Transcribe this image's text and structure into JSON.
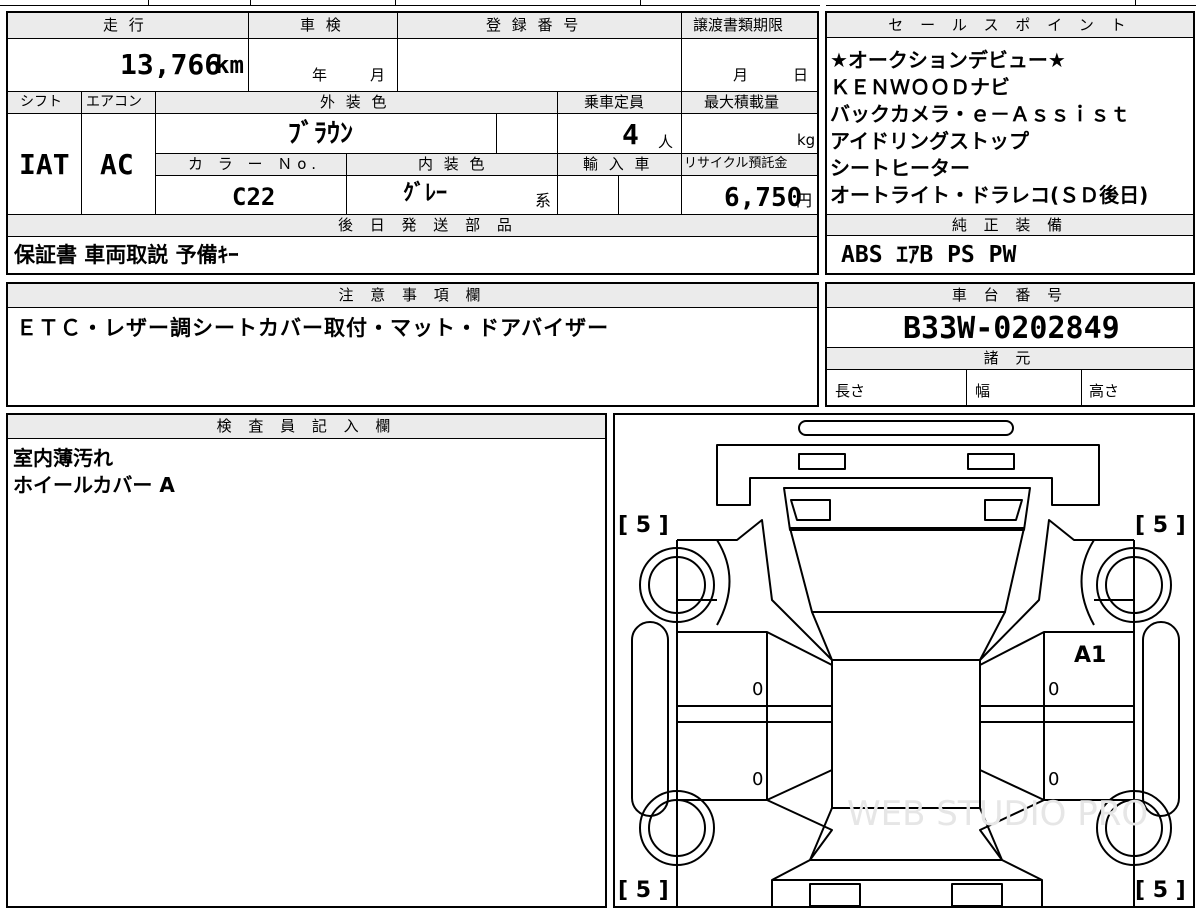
{
  "vehicle": {
    "header": {
      "mileage": "走 行",
      "inspection": "車 検",
      "registration_number": "登 録 番 号",
      "transfer_deadline": "譲渡書類期限"
    },
    "mileage_value": "13,766",
    "mileage_unit": "km",
    "inspection_year": "年",
    "inspection_month": "月",
    "deadline_month": "月",
    "deadline_day": "日",
    "shift_label": "シフト",
    "ac_label": "エアコン",
    "exterior_color_label": "外 装 色",
    "capacity_label": "乗車定員",
    "max_load_label": "最大積載量",
    "shift_value": "IAT",
    "ac_value": "AC",
    "exterior_color_value": "ﾌﾞﾗｳﾝ",
    "capacity_value": "4",
    "capacity_unit": "人",
    "max_load_unit": "kg",
    "color_no_label": "カ ラ ー Ｎo.",
    "interior_color_label": "内 装 色",
    "import_label": "輸 入 車",
    "recycle_label": "リサイクル預託金",
    "color_no_value": "C22",
    "interior_color_value": "ｸﾞﾚｰ",
    "interior_color_suffix": "系",
    "recycle_value": "6,750",
    "recycle_unit": "円",
    "later_parts_label": "後 日 発 送 部 品",
    "later_parts_value": "保証書 車両取説 予備ｷｰ"
  },
  "sales": {
    "header": "セ ー ル ス ポ イ ン ト",
    "lines": [
      "★オークションデビュー★",
      "ＫＥＮＷＯＯＤナビ",
      "バックカメラ・ｅ－Ａｓｓｉｓｔ",
      "アイドリングストップ",
      "シートヒーター",
      "オートライト・ドラレコ(ＳＤ後日)"
    ],
    "genuine_header": "純 正 装 備",
    "genuine_value": "ABS ｴｱB PS PW"
  },
  "notes": {
    "header": "注 意 事 項 欄",
    "text": "ＥＴＣ・レザー調シートカバー取付・マット・ドアバイザー"
  },
  "chassis": {
    "header": "車 台 番 号",
    "value": "B33W-0202849",
    "specs_header": "諸 元",
    "length_label": "長さ",
    "width_label": "幅",
    "height_label": "高さ"
  },
  "inspector": {
    "header": "検 査 員 記 入 欄",
    "lines": [
      "室内薄汚れ",
      "ホイールカバー A"
    ]
  },
  "diagram": {
    "tire_front_left": "[ 5 ]",
    "tire_front_right": "[ 5 ]",
    "tire_rear_left": "[ 5 ]",
    "tire_rear_right": "[ 5 ]",
    "door_marks": [
      "0",
      "0",
      "0",
      "0"
    ],
    "damage_code": "A1",
    "watermark": "WEB STUDIO PRO"
  }
}
